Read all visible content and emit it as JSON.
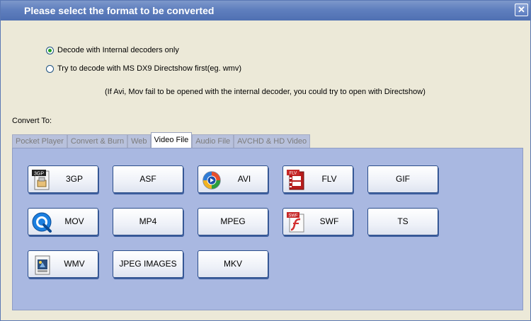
{
  "window": {
    "title": "Please select the format to be converted",
    "close_glyph": "✕"
  },
  "options": {
    "internal_label": "Decode with Internal decoders only",
    "directshow_label": "Try to decode with MS DX9 Directshow first(eg. wmv)",
    "selected": "internal",
    "note": "(If Avi, Mov fail to be opened with the internal decoder, you could try to open with Directshow)"
  },
  "convert_to_label": "Convert To:",
  "tabs": [
    {
      "label": "Pocket  Player"
    },
    {
      "label": "Convert & Burn"
    },
    {
      "label": "Web"
    },
    {
      "label": "Video  File",
      "active": true
    },
    {
      "label": "Audio  File"
    },
    {
      "label": "AVCHD & HD Video"
    }
  ],
  "formats": [
    {
      "label": "3GP",
      "icon": "3gp-file-icon",
      "badge": "3GP"
    },
    {
      "label": "ASF"
    },
    {
      "label": "AVI",
      "icon": "avi-play-icon"
    },
    {
      "label": "FLV",
      "icon": "flv-film-icon",
      "badge": "FLV"
    },
    {
      "label": "GIF"
    },
    {
      "label": "MOV",
      "icon": "quicktime-icon"
    },
    {
      "label": "MP4"
    },
    {
      "label": "MPEG"
    },
    {
      "label": "SWF",
      "icon": "flash-icon",
      "badge": "SWF"
    },
    {
      "label": "TS"
    },
    {
      "label": "WMV",
      "icon": "wmv-file-icon"
    },
    {
      "label": "JPEG IMAGES"
    },
    {
      "label": "MKV"
    }
  ],
  "colors": {
    "title_bar": "#6a87c4",
    "panel": "#a9b8e1",
    "button_border": "#2a4d8a"
  }
}
